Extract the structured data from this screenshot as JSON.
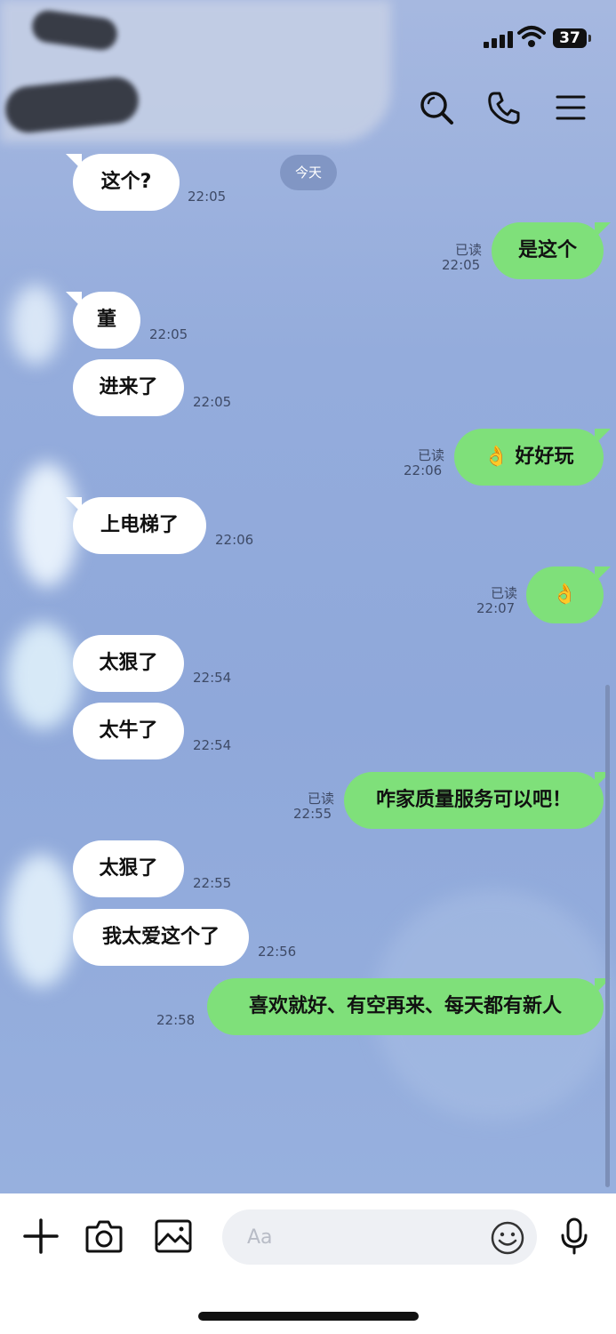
{
  "status": {
    "battery": "37"
  },
  "chat": {
    "date_label": "今天",
    "read_label": "已读",
    "messages": [
      {
        "dir": "in",
        "text": "这个?",
        "time": "22:05"
      },
      {
        "dir": "out",
        "text": "是这个",
        "time": "22:05",
        "read": true
      },
      {
        "dir": "in",
        "text": "董",
        "time": "22:05"
      },
      {
        "dir": "in",
        "text": "进来了",
        "time": "22:05"
      },
      {
        "dir": "out",
        "text": "👌 好好玩",
        "time": "22:06",
        "read": true
      },
      {
        "dir": "in",
        "text": "上电梯了",
        "time": "22:06"
      },
      {
        "dir": "out",
        "text": "👌",
        "time": "22:07",
        "read": true
      },
      {
        "dir": "in",
        "text": "太狠了",
        "time": "22:54"
      },
      {
        "dir": "in",
        "text": "太牛了",
        "time": "22:54"
      },
      {
        "dir": "out",
        "text": "咋家质量服务可以吧！",
        "time": "22:55",
        "read": true
      },
      {
        "dir": "in",
        "text": "太狠了",
        "time": "22:55"
      },
      {
        "dir": "in",
        "text": "我太爱这个了",
        "time": "22:56"
      },
      {
        "dir": "out",
        "text": "喜欢就好、有空再来、每天都有新人",
        "time": "22:58",
        "read": false
      }
    ]
  },
  "composer": {
    "placeholder": "Aa"
  },
  "icons": {
    "header": [
      "search-icon",
      "phone-icon",
      "menu-icon"
    ],
    "composer": [
      "plus-icon",
      "camera-icon",
      "image-icon",
      "emoji-icon",
      "mic-icon"
    ]
  },
  "colors": {
    "chat_background": "#94acdc",
    "outgoing_bubble": "#7fe07a",
    "incoming_bubble": "#ffffff"
  }
}
